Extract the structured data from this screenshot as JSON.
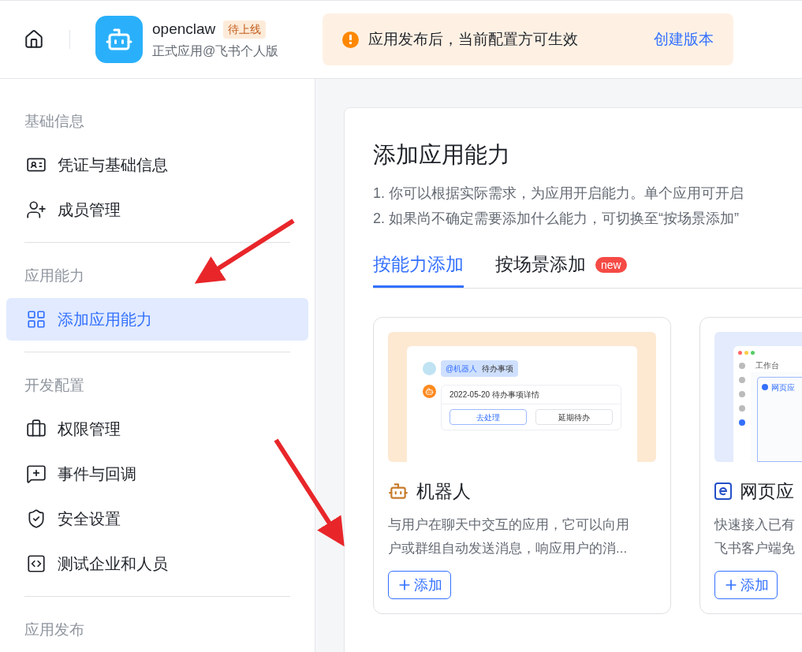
{
  "header": {
    "app": {
      "name": "openclaw",
      "status": "待上线",
      "subtitle": "正式应用@飞书个人版"
    },
    "notice": {
      "text": "应用发布后，当前配置方可生效",
      "link": "创建版本"
    }
  },
  "sidebar": {
    "sections": [
      {
        "title": "基础信息",
        "items": [
          {
            "label": "凭证与基础信息",
            "selected": false
          },
          {
            "label": "成员管理",
            "selected": false
          }
        ]
      },
      {
        "title": "应用能力",
        "items": [
          {
            "label": "添加应用能力",
            "selected": true
          }
        ]
      },
      {
        "title": "开发配置",
        "items": [
          {
            "label": "权限管理",
            "selected": false
          },
          {
            "label": "事件与回调",
            "selected": false
          },
          {
            "label": "安全设置",
            "selected": false
          },
          {
            "label": "测试企业和人员",
            "selected": false
          }
        ]
      },
      {
        "title": "应用发布"
      }
    ]
  },
  "main": {
    "title": "添加应用能力",
    "description": [
      "1. 你可以根据实际需求，为应用开启能力。单个应用可开启",
      "2. 如果尚不确定需要添加什么能力，可切换至“按场景添加”"
    ],
    "tabs": [
      {
        "label": "按能力添加",
        "selected": true
      },
      {
        "label": "按场景添加",
        "selected": false,
        "badge": "new"
      }
    ],
    "cards": [
      {
        "kind": "bot",
        "title": "机器人",
        "description": [
          "与用户在聊天中交互的应用，它可以向用",
          "户或群组自动发送消息，响应用户的消..."
        ],
        "button": "添加",
        "illustration": {
          "mention": "@机器人",
          "message": "待办事项",
          "card_title": "2022-05-20 待办事项详情",
          "primary": "去处理",
          "secondary": "延期待办"
        }
      },
      {
        "kind": "web",
        "title": "网页应",
        "description": [
          "快速接入已有",
          "飞书客户端免"
        ],
        "button": "添加",
        "illustration": {
          "tab": "工作台",
          "app_title": "网页应"
        }
      }
    ]
  }
}
